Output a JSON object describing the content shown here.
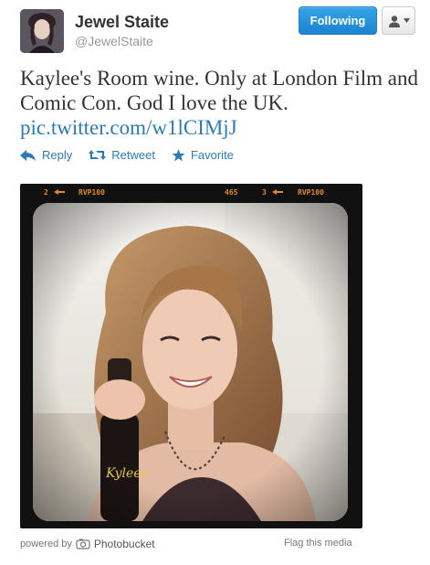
{
  "user": {
    "name": "Jewel Staite",
    "handle": "@JewelStaite"
  },
  "buttons": {
    "follow_label": "Following"
  },
  "tweet": {
    "text": "Kaylee's Room wine. Only at London Film and Comic Con. God I love the UK.",
    "link": "pic.twitter.com/w1lCIMjJ"
  },
  "actions": {
    "reply": "Reply",
    "retweet": "Retweet",
    "favorite": "Favorite"
  },
  "film_strip": {
    "left_frame": "2",
    "left_code": "RVP100",
    "counter": "465",
    "right_frame": "3",
    "right_code": "RVP100"
  },
  "footer": {
    "powered_by": "powered by",
    "provider": "Photobucket",
    "flag": "Flag this media"
  },
  "colors": {
    "accent": "#2b7bb9",
    "follow_button": "#1f83d2",
    "film_text": "#e08a2a"
  }
}
